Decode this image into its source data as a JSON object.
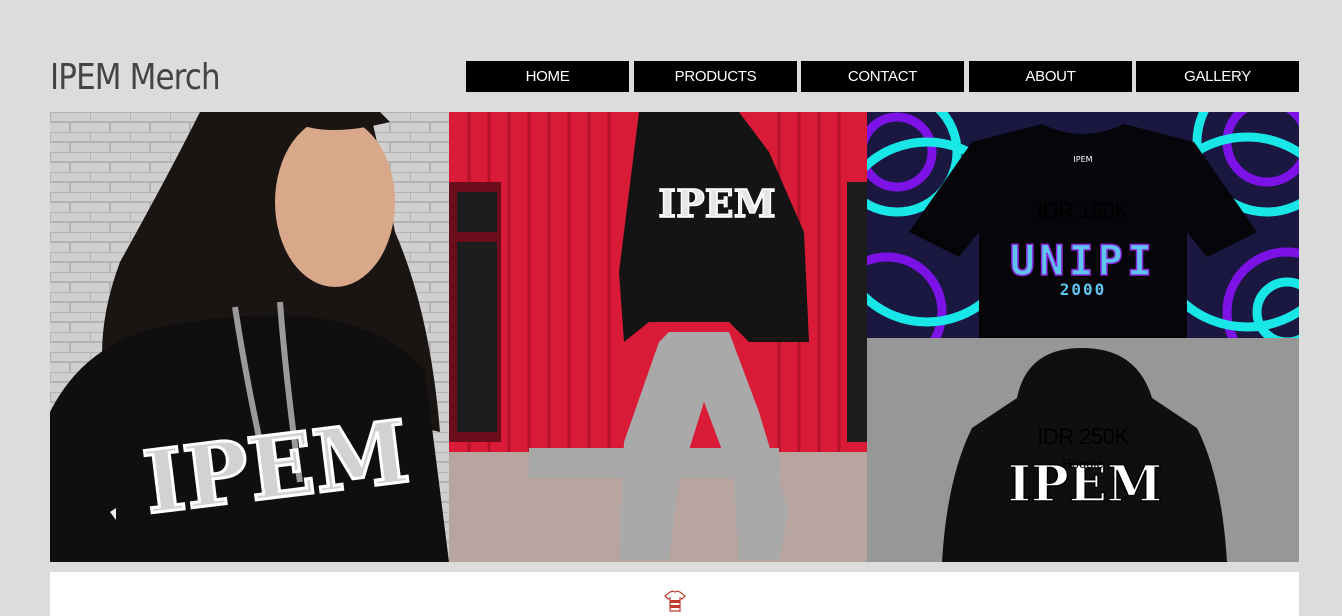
{
  "site": {
    "title": "IPEM Merch"
  },
  "nav": [
    {
      "label": "HOME"
    },
    {
      "label": "PRODUCTS"
    },
    {
      "label": "CONTACT"
    },
    {
      "label": "ABOUT"
    },
    {
      "label": "GALLERY"
    }
  ],
  "gallery": {
    "photo_1_print": "IPEM",
    "photo_2_print": "IPEM",
    "product_1": {
      "price": "IDR 150K",
      "print": "UNIPI",
      "print_year": "2000"
    },
    "product_2": {
      "price": "IDR 250K",
      "label": "Hoodie",
      "print": "IPEM"
    }
  },
  "footer": {
    "icon": "t-shirt-icon"
  },
  "colors": {
    "page_bg": "#dcdcdc",
    "nav_bg": "#000000",
    "nav_text": "#ffffff",
    "container_red": "#d91b37",
    "pattern_cyan": "#19e6e6",
    "pattern_purple": "#7d12e6"
  }
}
